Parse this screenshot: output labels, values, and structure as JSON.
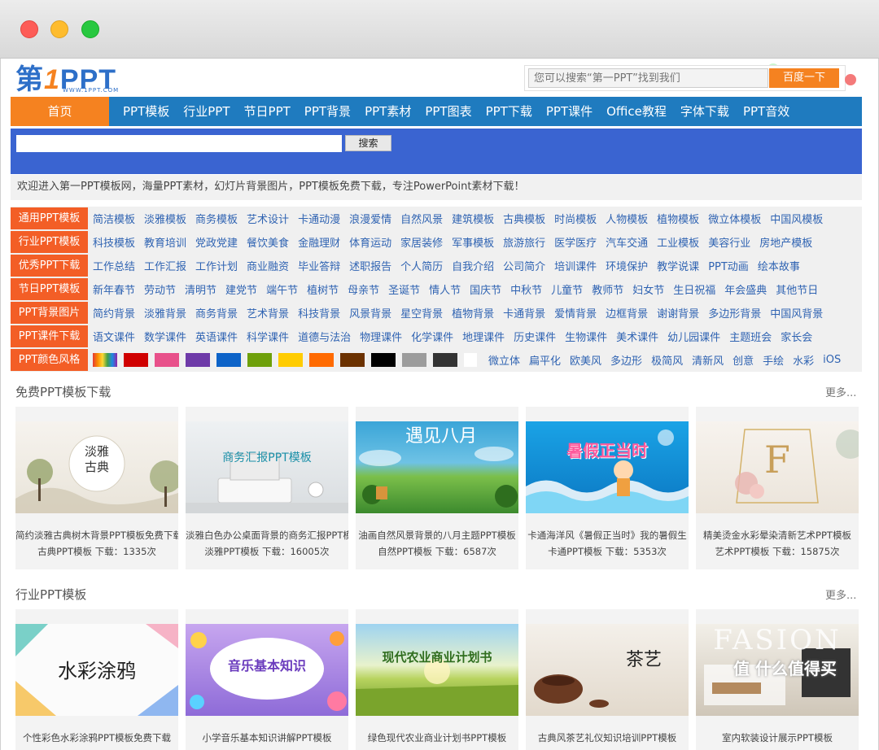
{
  "logo": {
    "main_a": "第",
    "main_b": "1",
    "main_c": "PPT",
    "sub": "WWW.1PPT.COM"
  },
  "search": {
    "placeholder": "您可以搜索“第一PPT”找到我们",
    "button": "百度一下"
  },
  "nav": {
    "home": "首页",
    "items": [
      "PPT模板",
      "行业PPT",
      "节日PPT",
      "PPT背景",
      "PPT素材",
      "PPT图表",
      "PPT下载",
      "PPT课件",
      "Office教程",
      "字体下载",
      "PPT音效"
    ]
  },
  "site_search": {
    "button": "搜索"
  },
  "welcome": "欢迎进入第一PPT模板网，海量PPT素材，幻灯片背景图片，PPT模板免费下载，专注PowerPoint素材下载！",
  "categories": [
    {
      "label": "通用PPT模板",
      "links": [
        "简洁模板",
        "淡雅模板",
        "商务模板",
        "艺术设计",
        "卡通动漫",
        "浪漫爱情",
        "自然风景",
        "建筑模板",
        "古典模板",
        "时尚模板",
        "人物模板",
        "植物模板",
        "微立体模板",
        "中国风模板"
      ]
    },
    {
      "label": "行业PPT模板",
      "links": [
        "科技模板",
        "教育培训",
        "党政党建",
        "餐饮美食",
        "金融理财",
        "体育运动",
        "家居装修",
        "军事模板",
        "旅游旅行",
        "医学医疗",
        "汽车交通",
        "工业模板",
        "美容行业",
        "房地产模板"
      ]
    },
    {
      "label": "优秀PPT下载",
      "links": [
        "工作总结",
        "工作汇报",
        "工作计划",
        "商业融资",
        "毕业答辩",
        "述职报告",
        "个人简历",
        "自我介绍",
        "公司简介",
        "培训课件",
        "环境保护",
        "教学说课",
        "PPT动画",
        "绘本故事"
      ]
    },
    {
      "label": "节日PPT模板",
      "links": [
        "新年春节",
        "劳动节",
        "清明节",
        "建党节",
        "端午节",
        "植树节",
        "母亲节",
        "圣诞节",
        "情人节",
        "国庆节",
        "中秋节",
        "儿童节",
        "教师节",
        "妇女节",
        "生日祝福",
        "年会盛典",
        "其他节日"
      ]
    },
    {
      "label": "PPT背景图片",
      "links": [
        "简约背景",
        "淡雅背景",
        "商务背景",
        "艺术背景",
        "科技背景",
        "风景背景",
        "星空背景",
        "植物背景",
        "卡通背景",
        "爱情背景",
        "边框背景",
        "谢谢背景",
        "多边形背景",
        "中国风背景"
      ]
    },
    {
      "label": "PPT课件下载",
      "links": [
        "语文课件",
        "数学课件",
        "英语课件",
        "科学课件",
        "道德与法治",
        "物理课件",
        "化学课件",
        "地理课件",
        "历史课件",
        "生物课件",
        "美术课件",
        "幼儿园课件",
        "主题班会",
        "家长会"
      ]
    }
  ],
  "color_row": {
    "label": "PPT颜色风格",
    "swatches": [
      "rainbow",
      "#d00000",
      "#e8508a",
      "#6e3aa8",
      "#0d63c8",
      "#6ea00a",
      "#ffcc00",
      "#ff6a00",
      "#6b3100",
      "#000000",
      "#9c9c9c",
      "#333333",
      "#ffffff"
    ],
    "links": [
      "微立体",
      "扁平化",
      "欧美风",
      "多边形",
      "极简风",
      "清新风",
      "创意",
      "手绘",
      "水彩",
      "iOS"
    ]
  },
  "section1": {
    "title": "免费PPT模板下载",
    "more": "更多...",
    "cards": [
      {
        "title": "简约淡雅古典树木背景PPT模板免费下载",
        "meta": "古典PPT模板  下载：1335次",
        "thumb_text": "淡雅古典"
      },
      {
        "title": "淡雅白色办公桌面背景的商务汇报PPT模板",
        "meta": "淡雅PPT模板  下载：16005次",
        "thumb_text": "商务汇报PPT模板"
      },
      {
        "title": "油画自然风景背景的八月主题PPT模板",
        "meta": "自然PPT模板  下载：6587次",
        "thumb_text": "遇见八月"
      },
      {
        "title": "卡通海洋风《暑假正当时》我的暑假生",
        "meta": "卡通PPT模板  下载：5353次",
        "thumb_text": "暑假正当时"
      },
      {
        "title": "精美烫金水彩晕染清新艺术PPT模板",
        "meta": "艺术PPT模板  下载：15875次",
        "thumb_text": "F"
      }
    ]
  },
  "section2": {
    "title": "行业PPT模板",
    "more": "更多...",
    "cards": [
      {
        "title": "个性彩色水彩涂鸦PPT模板免费下载",
        "thumb_text": "水彩涂鸦"
      },
      {
        "title": "小学音乐基本知识讲解PPT模板",
        "thumb_text": "音乐基本知识"
      },
      {
        "title": "绿色现代农业商业计划书PPT模板",
        "thumb_text": "现代农业商业计划书"
      },
      {
        "title": "古典风茶艺礼仪知识培训PPT模板",
        "thumb_text": "茶艺"
      },
      {
        "title": "室内软装设计展示PPT模板",
        "thumb_text": "FASION"
      }
    ]
  },
  "watermark": "值 什么值得买"
}
